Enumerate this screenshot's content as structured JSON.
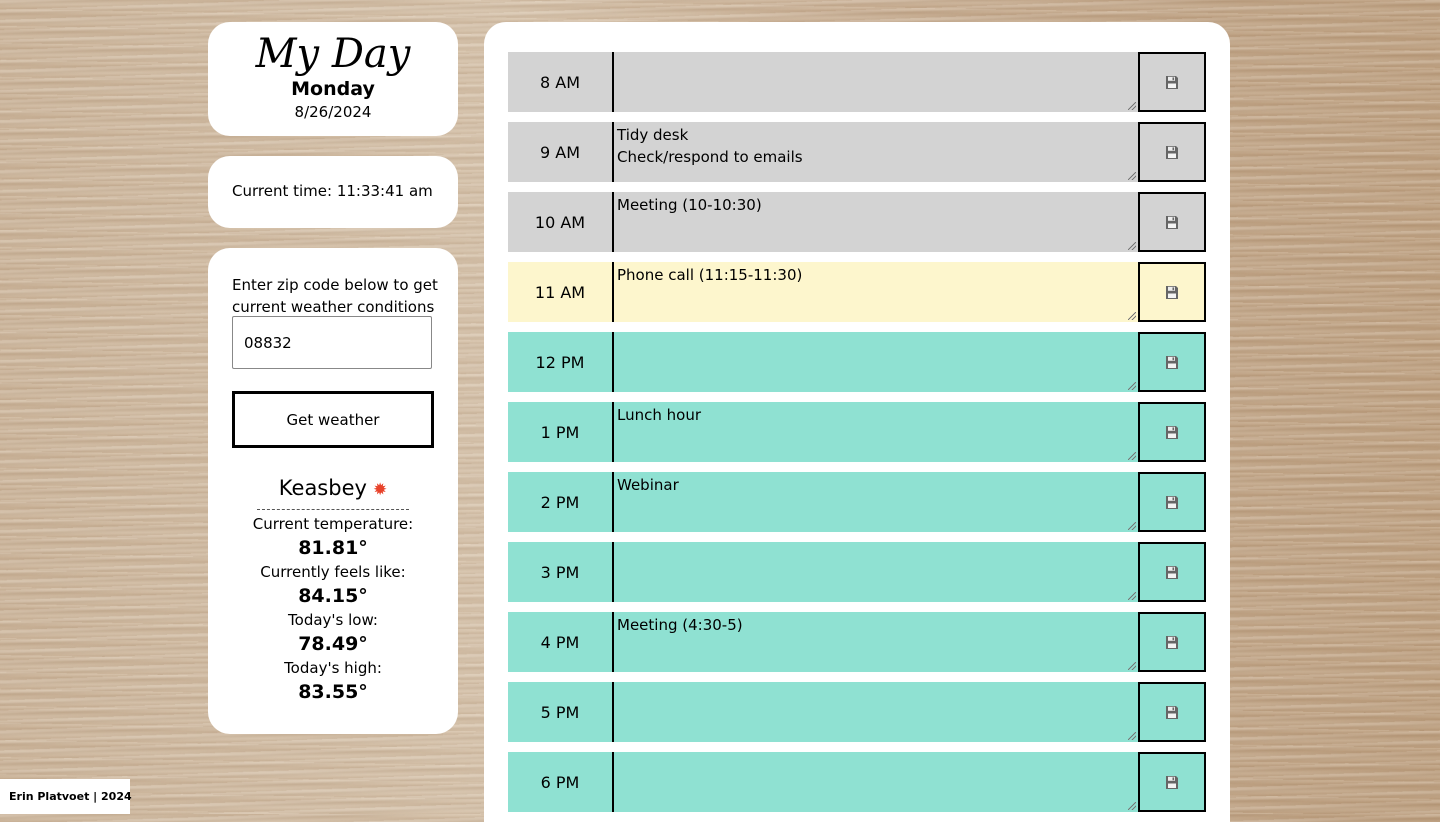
{
  "header": {
    "title": "My Day",
    "day": "Monday",
    "date": "8/26/2024"
  },
  "clock": {
    "text": "Current time: 11:33:41 am"
  },
  "weather": {
    "prompt": "Enter zip code below to get current weather conditions",
    "zip_value": "08832",
    "button_label": "Get weather",
    "city": "Keasbey",
    "icon": "sun-icon",
    "stats": [
      {
        "label": "Current temperature:",
        "value": "81.81°"
      },
      {
        "label": "Currently feels like:",
        "value": "84.15°"
      },
      {
        "label": "Today's low:",
        "value": "78.49°"
      },
      {
        "label": "Today's high:",
        "value": "83.55°"
      }
    ]
  },
  "planner": {
    "rows": [
      {
        "hour": "8 AM",
        "text": "",
        "state": "past"
      },
      {
        "hour": "9 AM",
        "text": "Tidy desk\nCheck/respond to emails",
        "state": "past"
      },
      {
        "hour": "10 AM",
        "text": "Meeting (10-10:30)",
        "state": "past"
      },
      {
        "hour": "11 AM",
        "text": "Phone call (11:15-11:30)",
        "state": "present"
      },
      {
        "hour": "12 PM",
        "text": "",
        "state": "future"
      },
      {
        "hour": "1 PM",
        "text": "Lunch hour",
        "state": "future"
      },
      {
        "hour": "2 PM",
        "text": "Webinar",
        "state": "future"
      },
      {
        "hour": "3 PM",
        "text": "",
        "state": "future"
      },
      {
        "hour": "4 PM",
        "text": "Meeting (4:30-5)",
        "state": "future"
      },
      {
        "hour": "5 PM",
        "text": "",
        "state": "future"
      },
      {
        "hour": "6 PM",
        "text": "",
        "state": "future"
      }
    ],
    "save_icon": "floppy-disk-icon"
  },
  "colors": {
    "past": "#d3d3d3",
    "present": "#fdf6cd",
    "future": "#8fe1d2"
  },
  "footer": {
    "credit": "Erin Platvoet | 2024"
  }
}
